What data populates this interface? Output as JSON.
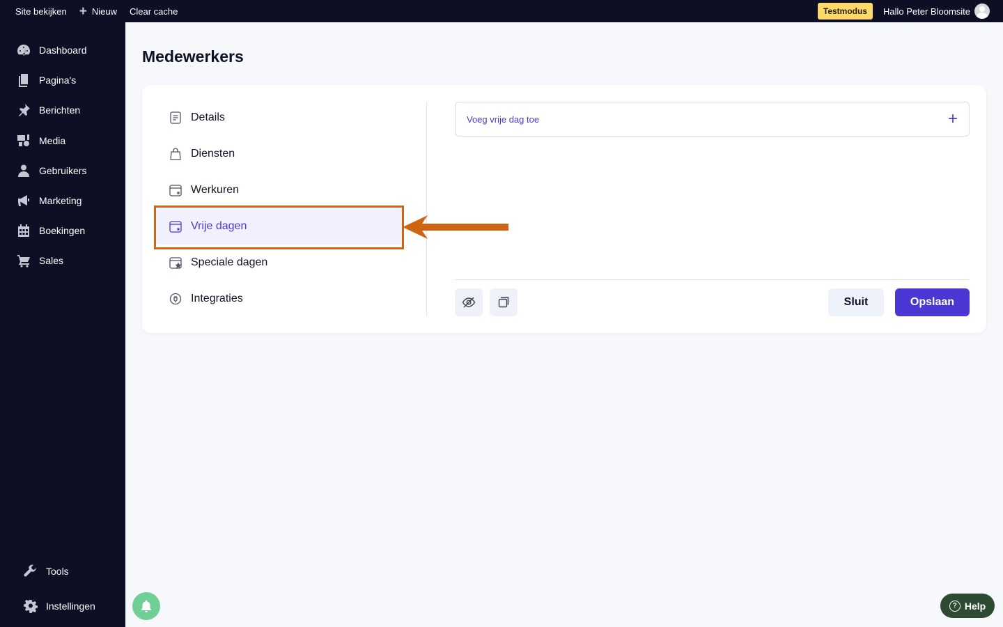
{
  "topbar": {
    "site_label": "Site bekijken",
    "new_label": "Nieuw",
    "clear_cache_label": "Clear cache",
    "mode_badge": "Testmodus",
    "greeting": "Hallo Peter Bloomsite"
  },
  "sidebar": {
    "items": [
      {
        "label": "Dashboard",
        "icon": "dashboard-icon"
      },
      {
        "label": "Pagina's",
        "icon": "pages-icon"
      },
      {
        "label": "Berichten",
        "icon": "pin-icon"
      },
      {
        "label": "Media",
        "icon": "media-icon"
      },
      {
        "label": "Gebruikers",
        "icon": "user-icon"
      },
      {
        "label": "Marketing",
        "icon": "megaphone-icon"
      },
      {
        "label": "Boekingen",
        "icon": "calendar-icon"
      },
      {
        "label": "Sales",
        "icon": "cart-icon"
      }
    ],
    "bottom": [
      {
        "label": "Tools",
        "icon": "wrench-icon"
      },
      {
        "label": "Instellingen",
        "icon": "gear-icon"
      }
    ]
  },
  "main": {
    "title": "Medewerkers",
    "menu": [
      {
        "label": "Details",
        "icon": "document-icon"
      },
      {
        "label": "Diensten",
        "icon": "bag-icon"
      },
      {
        "label": "Werkuren",
        "icon": "calendar-clock-icon"
      },
      {
        "label": "Vrije dagen",
        "icon": "calendar-x-icon",
        "active": true
      },
      {
        "label": "Speciale dagen",
        "icon": "calendar-star-icon"
      },
      {
        "label": "Integraties",
        "icon": "integration-icon"
      }
    ],
    "add_day_label": "Voeg vrije dag toe",
    "close_label": "Sluit",
    "save_label": "Opslaan"
  },
  "help_label": "Help",
  "colors": {
    "accent": "#4a37d4",
    "sidebar_bg": "#0d0f24",
    "highlight": "#cf6513",
    "badge": "#fcd96a"
  }
}
